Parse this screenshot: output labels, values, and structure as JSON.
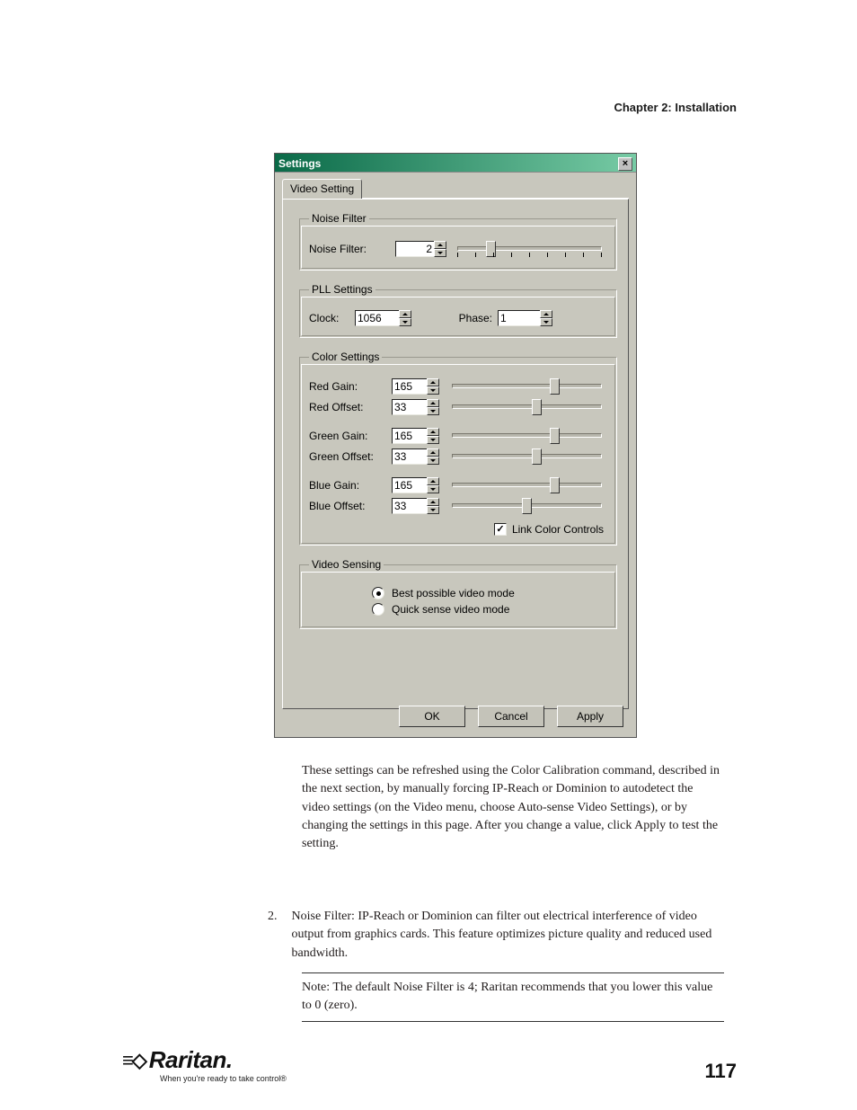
{
  "header": {
    "chapter": "Chapter 2: Installation"
  },
  "dialog": {
    "title": "Settings",
    "tab": "Video Setting",
    "noise_filter_group": {
      "legend": "Noise Filter",
      "label": "Noise Filter:",
      "value": "2",
      "ticks": 9,
      "thumb_pct": 22
    },
    "pll_group": {
      "legend": "PLL Settings",
      "clock_label": "Clock:",
      "clock_value": "1056",
      "phase_label": "Phase:",
      "phase_value": "1"
    },
    "color_group": {
      "legend": "Color Settings",
      "rows": [
        {
          "label": "Red Gain:",
          "value": "165",
          "thumb_pct": 64
        },
        {
          "label": "Red Offset:",
          "value": "33",
          "thumb_pct": 53
        },
        {
          "label": "Green Gain:",
          "value": "165",
          "thumb_pct": 64
        },
        {
          "label": "Green Offset:",
          "value": "33",
          "thumb_pct": 53
        },
        {
          "label": "Blue Gain:",
          "value": "165",
          "thumb_pct": 64
        },
        {
          "label": "Blue Offset:",
          "value": "33",
          "thumb_pct": 47
        }
      ],
      "link_checked": true,
      "link_label": "Link Color Controls"
    },
    "video_sensing_group": {
      "legend": "Video Sensing",
      "best_label": "Best possible video mode",
      "quick_label": "Quick sense video mode",
      "selected": "best"
    },
    "buttons": {
      "ok": "OK",
      "cancel": "Cancel",
      "apply": "Apply"
    }
  },
  "paragraph": "These settings can be refreshed using the Color Calibration command, described in the next section, by manually forcing IP-Reach or Dominion to autodetect the video settings (on the Video menu, choose Auto-sense Video Settings), or by changing the settings in this page. After you change a value, click Apply to test the setting.",
  "list": {
    "number": "2.",
    "text": "Noise Filter: IP-Reach or Dominion can filter out electrical interference of video output from graphics cards. This feature optimizes picture quality and reduced used bandwidth."
  },
  "note": "Note: The default Noise Filter is 4; Raritan recommends that you lower this value to 0 (zero).",
  "footer": {
    "brand": "Raritan.",
    "tagline": "When you're ready to take control®",
    "page": "117"
  }
}
